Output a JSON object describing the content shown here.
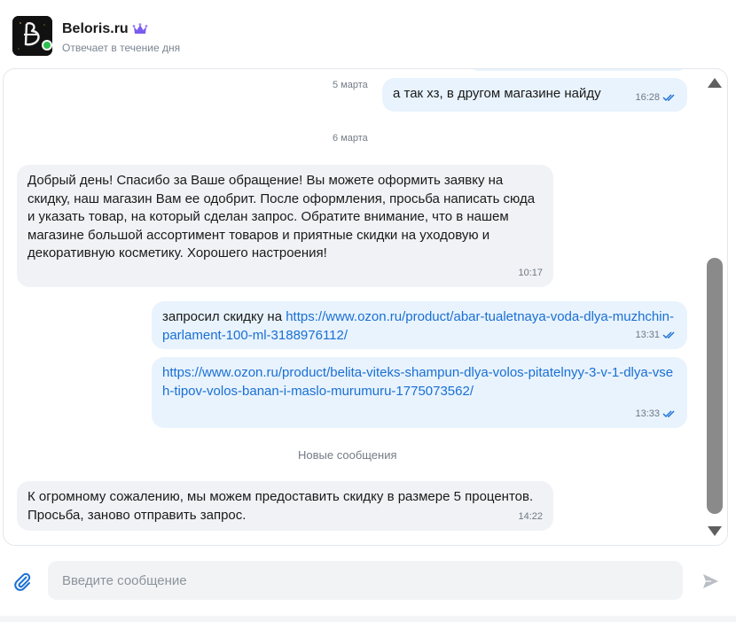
{
  "header": {
    "shop_name": "Beloris.ru",
    "status": "Отвечает в течение дня",
    "avatar_letter": "B",
    "crown_icon": "crown-icon",
    "crown_color": "#7b5cf0",
    "online_color": "#2fbf4f"
  },
  "messages": [
    {
      "date_label": "5 марта"
    },
    {
      "direction": "out",
      "text": "а так хз, в другом магазине найду",
      "time": "16:28",
      "read": true
    },
    {
      "date_label": "6 марта"
    },
    {
      "direction": "in",
      "text": "Добрый день! Спасибо за Ваше обращение! Вы можете оформить заявку на скидку, наш магазин Вам ее одобрит. После оформления, просьба написать сюда и указать товар, на который сделан запрос. Обратите внимание, что в нашем магазине большой ассортимент товаров и приятные скидки на уходовую и декоративную косметику. Хорошего настроения!",
      "time": "10:17"
    },
    {
      "direction": "out",
      "text": "запросил скидку на ",
      "link": "https://www.ozon.ru/product/abar-tualetnaya-voda-dlya-muzhchin-parlament-100-ml-3188976112/",
      "time": "13:31",
      "read": true
    },
    {
      "direction": "out",
      "text": "",
      "link": "https://www.ozon.ru/product/belita-viteks-shampun-dlya-volos-pitatelnyy-3-v-1-dlya-vseh-tipov-volos-banan-i-maslo-murumuru-1775073562/",
      "time": "13:33",
      "read": true
    },
    {
      "system_label": "Новые сообщения"
    },
    {
      "direction": "in",
      "text": "К огромному сожалению, мы можем предоставить скидку в размере 5 процентов. Просьба, заново отправить запрос.",
      "time": "14:22"
    }
  ],
  "composer": {
    "placeholder": "Введите сообщение",
    "value": "",
    "attach_icon": "paperclip-icon",
    "send_icon": "send-icon"
  },
  "colors": {
    "accent": "#1a6fd4",
    "incoming_bubble": "#f0f2f5",
    "outgoing_bubble": "#e8f3fd",
    "tick_color": "#1a6fd4"
  }
}
